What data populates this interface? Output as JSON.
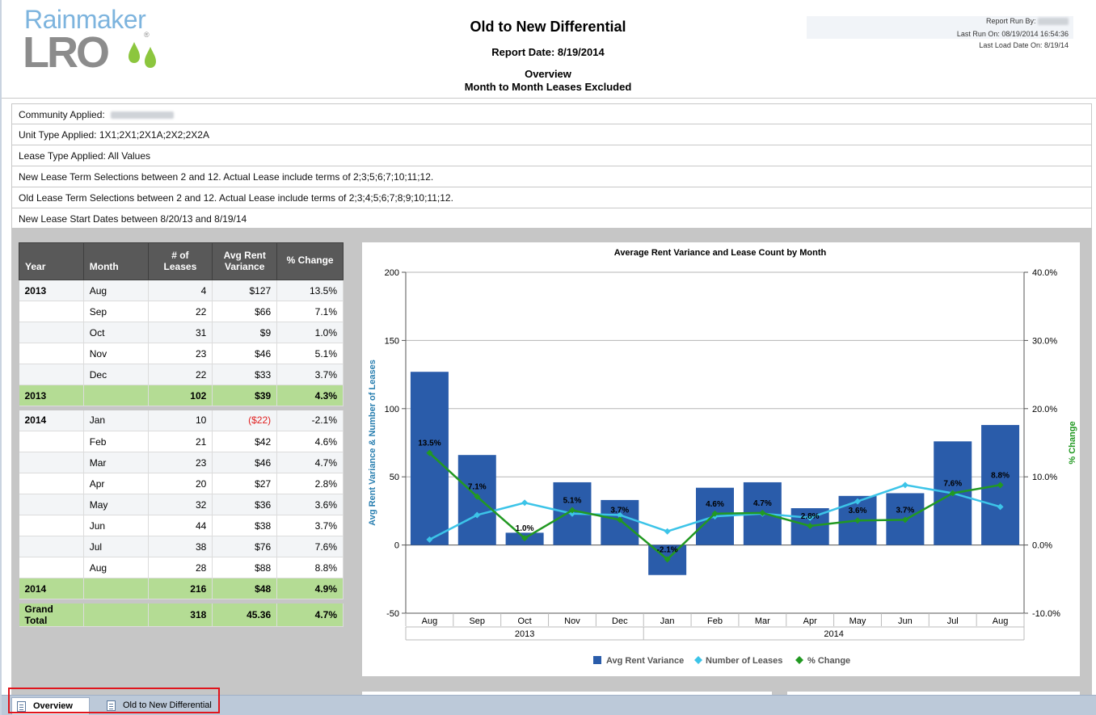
{
  "brand": {
    "top_text": "Rainmaker",
    "bottom_text": "LRO",
    "registered": "®"
  },
  "report": {
    "title": "Old to New Differential",
    "date_line": "Report Date: 8/19/2014",
    "view": "Overview",
    "subtitle": "Month to Month Leases Excluded"
  },
  "run_info": {
    "run_by_label": "Report Run By:",
    "last_run_label": "Last Run On: 08/19/2014 16:54:36",
    "last_load_label": "Last Load Date On: 8/19/14"
  },
  "filters": {
    "community_label": "Community Applied:",
    "unit_type": "Unit Type Applied: 1X1;2X1;2X1A;2X2;2X2A",
    "lease_type": "Lease Type Applied: All Values",
    "new_term": "New Lease Term Selections between 2 and 12. Actual Lease include terms of 2;3;5;6;7;10;11;12.",
    "old_term": "Old Lease Term Selections between 2 and 12. Actual Lease include terms of 2;3;4;5;6;7;8;9;10;11;12.",
    "start_dates": "New Lease Start Dates between 8/20/13 and 8/19/14"
  },
  "table": {
    "headers": {
      "year": "Year",
      "month": "Month",
      "leases": "# of Leases",
      "variance_line1": "Avg Rent",
      "variance_line2": "Variance",
      "change": "% Change"
    },
    "rows_2013": [
      {
        "year": "2013",
        "month": "Aug",
        "leases": "4",
        "variance": "$127",
        "change": "13.5%"
      },
      {
        "year": "",
        "month": "Sep",
        "leases": "22",
        "variance": "$66",
        "change": "7.1%"
      },
      {
        "year": "",
        "month": "Oct",
        "leases": "31",
        "variance": "$9",
        "change": "1.0%"
      },
      {
        "year": "",
        "month": "Nov",
        "leases": "23",
        "variance": "$46",
        "change": "5.1%"
      },
      {
        "year": "",
        "month": "Dec",
        "leases": "22",
        "variance": "$33",
        "change": "3.7%"
      }
    ],
    "subtotal_2013": {
      "year": "2013",
      "leases": "102",
      "variance": "$39",
      "change": "4.3%"
    },
    "rows_2014": [
      {
        "year": "2014",
        "month": "Jan",
        "leases": "10",
        "variance": "($22)",
        "change": "-2.1%"
      },
      {
        "year": "",
        "month": "Feb",
        "leases": "21",
        "variance": "$42",
        "change": "4.6%"
      },
      {
        "year": "",
        "month": "Mar",
        "leases": "23",
        "variance": "$46",
        "change": "4.7%"
      },
      {
        "year": "",
        "month": "Apr",
        "leases": "20",
        "variance": "$27",
        "change": "2.8%"
      },
      {
        "year": "",
        "month": "May",
        "leases": "32",
        "variance": "$36",
        "change": "3.6%"
      },
      {
        "year": "",
        "month": "Jun",
        "leases": "44",
        "variance": "$38",
        "change": "3.7%"
      },
      {
        "year": "",
        "month": "Jul",
        "leases": "38",
        "variance": "$76",
        "change": "7.6%"
      },
      {
        "year": "",
        "month": "Aug",
        "leases": "28",
        "variance": "$88",
        "change": "8.8%"
      }
    ],
    "subtotal_2014": {
      "year": "2014",
      "leases": "216",
      "variance": "$48",
      "change": "4.9%"
    },
    "grand_total": {
      "label": "Grand Total",
      "leases": "318",
      "variance": "45.36",
      "change": "4.7%"
    }
  },
  "chart_data": {
    "type": "bar",
    "title": "Average Rent Variance and Lease Count by Month",
    "ylabel": "Avg Rent Variance & Number of Leases",
    "y2label": "% Change",
    "ylim": [
      -50,
      200
    ],
    "y2lim": [
      -10,
      40
    ],
    "yticks": [
      "200",
      "150",
      "100",
      "50",
      "0",
      "-50"
    ],
    "y2ticks": [
      "40.0%",
      "30.0%",
      "20.0%",
      "10.0%",
      "0.0%",
      "-10.0%"
    ],
    "categories": [
      "Aug",
      "Sep",
      "Oct",
      "Nov",
      "Dec",
      "Jan",
      "Feb",
      "Mar",
      "Apr",
      "May",
      "Jun",
      "Jul",
      "Aug"
    ],
    "year_groups": [
      {
        "label": "2013",
        "count": 5
      },
      {
        "label": "2014",
        "count": 8
      }
    ],
    "series": [
      {
        "name": "Avg Rent Variance",
        "kind": "bar",
        "axis": "left",
        "color": "#2a5caa",
        "values": [
          127,
          66,
          9,
          46,
          33,
          -22,
          42,
          46,
          27,
          36,
          38,
          76,
          88
        ]
      },
      {
        "name": "Number of Leases",
        "kind": "line",
        "axis": "left",
        "color": "#3cc4e8",
        "values": [
          4,
          22,
          31,
          23,
          22,
          10,
          21,
          23,
          20,
          32,
          44,
          38,
          28
        ]
      },
      {
        "name": "% Change",
        "kind": "line",
        "axis": "right",
        "color": "#229922",
        "values": [
          13.5,
          7.1,
          1.0,
          5.1,
          3.7,
          -2.1,
          4.6,
          4.7,
          2.8,
          3.6,
          3.7,
          7.6,
          8.8
        ],
        "labels": [
          "13.5%",
          "7.1%",
          "1.0%",
          "5.1%",
          "3.7%",
          "-2.1%",
          "4.6%",
          "4.7%",
          "2.8%",
          "3.6%",
          "3.7%",
          "7.6%",
          "8.8%"
        ]
      }
    ],
    "grid": true,
    "legend_position": "bottom"
  },
  "tabs": {
    "overview": "Overview",
    "differential": "Old to New Differential"
  },
  "colors": {
    "subtotal_green": "#b4dc94",
    "header_grey": "#595959",
    "highlight_red": "#e0141c"
  }
}
